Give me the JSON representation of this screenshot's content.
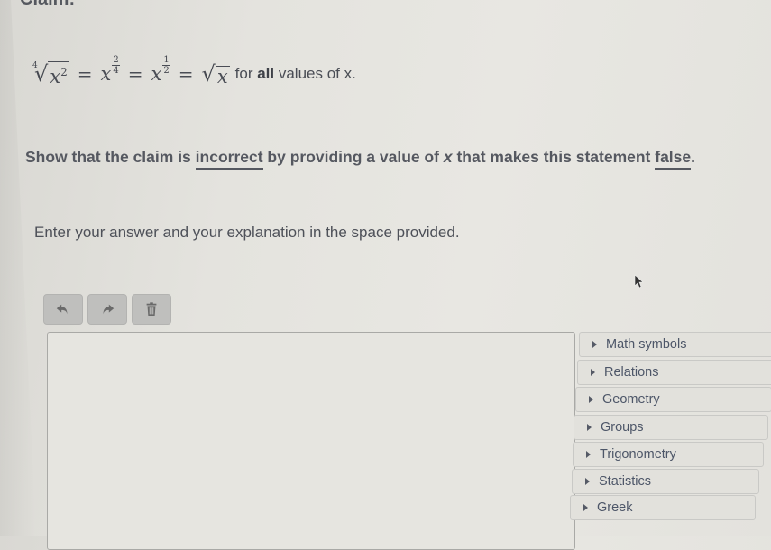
{
  "claim": {
    "label": "Claim:",
    "equation": {
      "root_index": "4",
      "radicand_base": "x",
      "radicand_exp": "2",
      "equals": "=",
      "term2_base": "x",
      "term2_num": "2",
      "term2_den": "4",
      "term3_base": "x",
      "term3_num": "1",
      "term3_den": "2",
      "sqrt_symbol": "√",
      "fourth_root_symbol": "√",
      "sqrt_radicand": "x",
      "suffix_pre": "for ",
      "suffix_bold": "all",
      "suffix_post": " values of x."
    }
  },
  "instruction": {
    "part1": "Show that the claim is ",
    "underlined1": "incorrect",
    "part2": " by providing a value of ",
    "italic_x": "x",
    "part3": " that makes this statement ",
    "underlined2": "false",
    "part4": "."
  },
  "prompt": "Enter your answer and your explanation in the space provided.",
  "toolbar": {
    "undo_icon": "undo-arrow-icon",
    "redo_icon": "redo-arrow-icon",
    "delete_icon": "trash-icon"
  },
  "answer_box": {
    "value": ""
  },
  "palette": {
    "items": [
      {
        "label": "Math symbols"
      },
      {
        "label": "Relations"
      },
      {
        "label": "Geometry"
      },
      {
        "label": "Groups"
      },
      {
        "label": "Trigonometry"
      },
      {
        "label": "Statistics"
      },
      {
        "label": "Greek"
      }
    ]
  }
}
